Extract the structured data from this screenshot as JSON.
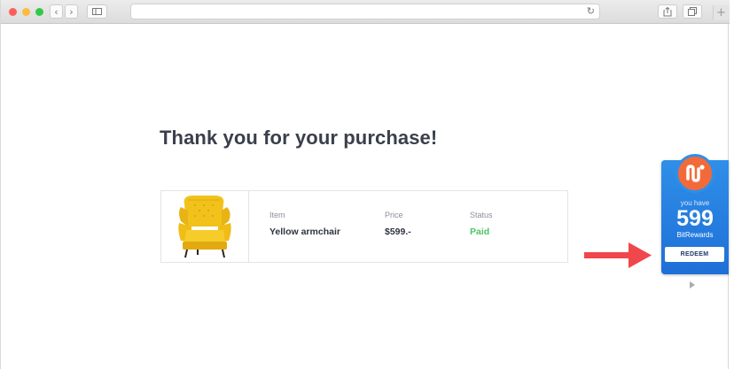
{
  "browser": {
    "traffic_lights": {
      "close": "#fc605b",
      "minimize": "#fdbc40",
      "zoom": "#34c84a"
    },
    "back_glyph": "‹",
    "forward_glyph": "›",
    "reload_glyph": "↻",
    "new_tab_glyph": "+",
    "icons": [
      "back-icon",
      "forward-icon",
      "sidebar-icon",
      "reload-icon",
      "share-icon",
      "tabs-icon",
      "add-tab-icon"
    ]
  },
  "page": {
    "title": "Thank you for your purchase!"
  },
  "order": {
    "item_label": "Item",
    "item_value": "Yellow armchair",
    "price_label": "Price",
    "price_value": "$599.-",
    "status_label": "Status",
    "status_value": "Paid",
    "status_color": "#4cc36a"
  },
  "widget": {
    "you_have": "you have",
    "points": "599",
    "brand": "BitRewards",
    "redeem_label": "REDEEM",
    "accent": "#2f8fe8",
    "logo_color": "#f26a3a"
  },
  "arrow_color": "#f0474c"
}
